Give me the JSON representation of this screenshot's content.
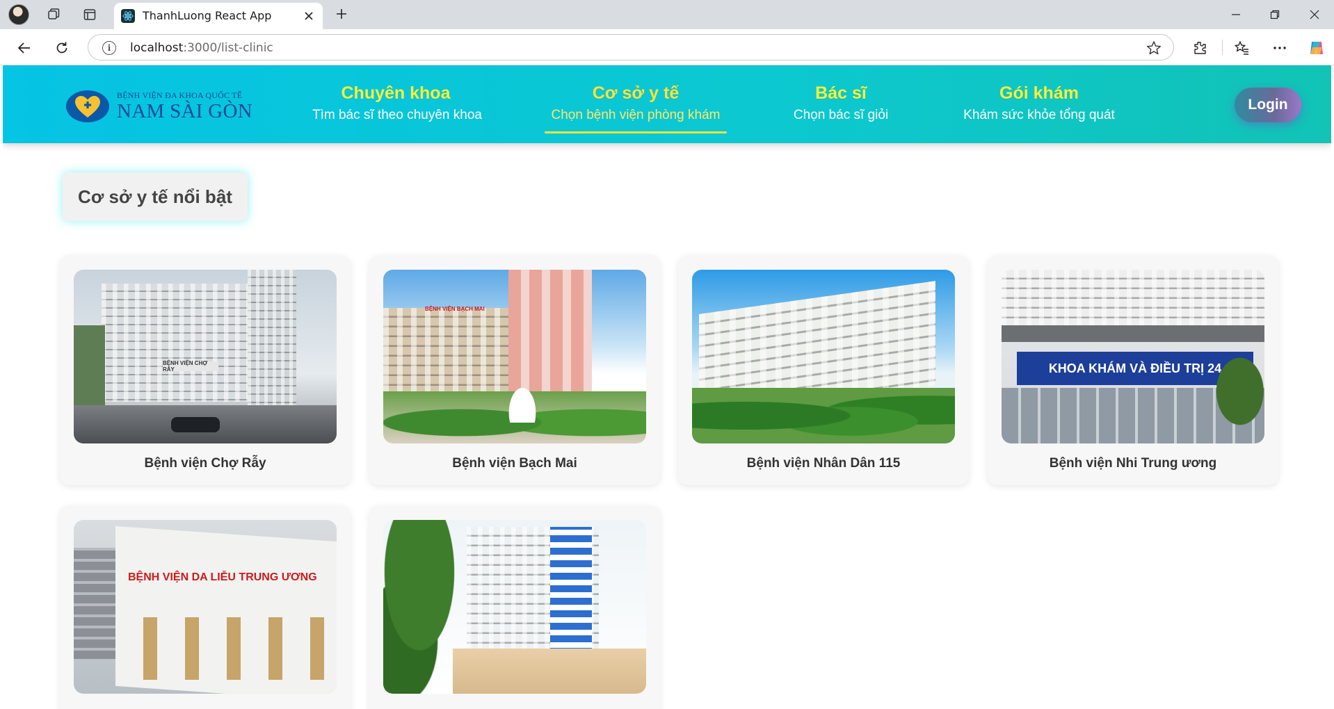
{
  "browser": {
    "tab_title": "ThanhLuong React App",
    "url_host": "localhost",
    "url_path": ":3000/list-clinic"
  },
  "header": {
    "logo_small": "BỆNH VIỆN ĐA KHOA QUỐC TẾ",
    "logo_big": "NAM SÀI GÒN",
    "nav": [
      {
        "title": "Chuyên khoa",
        "subtitle": "Tìm bác sĩ theo chuyên khoa",
        "active": false
      },
      {
        "title": "Cơ sở y tế",
        "subtitle": "Chọn bệnh viện phòng khám",
        "active": true
      },
      {
        "title": "Bác sĩ",
        "subtitle": "Chọn bác sĩ giỏi",
        "active": false
      },
      {
        "title": "Gói khám",
        "subtitle": "Khám sức khỏe tổng quát",
        "active": false
      }
    ],
    "login_label": "Login"
  },
  "main": {
    "section_title": "Cơ sở y tế nổi bật",
    "clinics": [
      {
        "name": "Bệnh viện Chợ Rẫy",
        "sign": "BỆNH VIỆN CHỢ RẪY"
      },
      {
        "name": "Bệnh viện Bạch Mai",
        "sign": "BỆNH VIỆN BẠCH MAI"
      },
      {
        "name": "Bệnh viện Nhân Dân 115",
        "sign": ""
      },
      {
        "name": "Bệnh viện Nhi Trung ương",
        "sign": "KHOA KHÁM VÀ ĐIỀU TRỊ 24"
      },
      {
        "name": "",
        "sign": "BỆNH VIỆN DA LIỄU TRUNG ƯƠNG"
      },
      {
        "name": "",
        "sign": ""
      }
    ]
  },
  "colors": {
    "header_start": "#05c4e4",
    "header_end": "#12c3b6",
    "nav_title": "#f5f23a",
    "active_accent": "#ffe23a",
    "login_gradient_end": "#9a78c8"
  }
}
